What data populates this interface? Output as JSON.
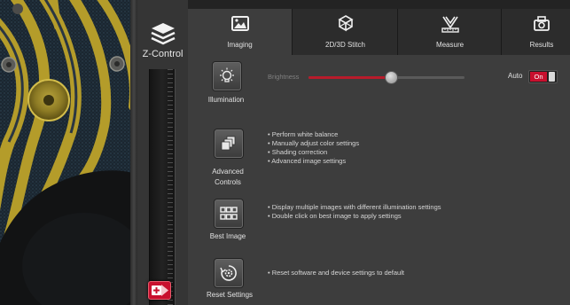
{
  "zcontrol": {
    "title": "Z-Control",
    "slider_position": 0.92
  },
  "tabs": [
    {
      "label": "Imaging",
      "icon": "image-icon",
      "active": true
    },
    {
      "label": "2D/3D Stitch",
      "icon": "stitch-icon",
      "active": false
    },
    {
      "label": "Measure",
      "icon": "measure-icon",
      "active": false
    },
    {
      "label": "Results",
      "icon": "results-icon",
      "active": false
    }
  ],
  "imaging": {
    "illumination": {
      "label": "Illumination",
      "icon": "lightbulb-icon"
    },
    "brightness": {
      "label": "Brightness",
      "value": 0.52
    },
    "auto": {
      "label": "Auto",
      "state": "On"
    },
    "advanced_controls": {
      "label_line1": "Advanced",
      "label_line2": "Controls",
      "icon": "layers-icon",
      "bullets": [
        "Perform white balance",
        "Manually adjust color settings",
        "Shading correction",
        "Advanced image settings"
      ]
    },
    "best_image": {
      "label": "Best Image",
      "icon": "grid-icon",
      "bullets": [
        "Display multiple images with different illumination settings",
        "Double click on best image to apply settings"
      ]
    },
    "reset_settings": {
      "label": "Reset Settings",
      "icon": "reset-gear-icon",
      "bullets": [
        "Reset software and device settings to default"
      ]
    }
  },
  "colors": {
    "accent_red": "#c8102e",
    "panel_bg": "#3d3d3d",
    "tabbar_bg": "#232323"
  }
}
